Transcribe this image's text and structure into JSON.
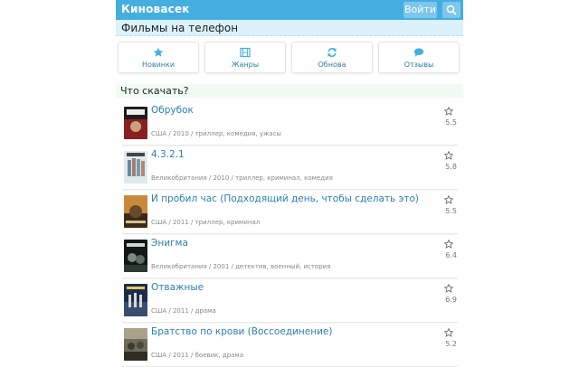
{
  "header": {
    "brand": "Киновасек",
    "login_label": "Войти"
  },
  "subheader": {
    "title": "Фильмы на телефон"
  },
  "nav": [
    {
      "label": "Новинки",
      "icon": "star-icon"
    },
    {
      "label": "Жанры",
      "icon": "film-icon"
    },
    {
      "label": "Обнова",
      "icon": "refresh-icon"
    },
    {
      "label": "Отзывы",
      "icon": "comment-icon"
    }
  ],
  "section": {
    "title": "Что скачать?"
  },
  "movies": [
    {
      "title": "Обрубок",
      "meta": "США / 2010 / триллер, комедия, ужасы",
      "rating": "5.5"
    },
    {
      "title": "4.3.2.1",
      "meta": "Великобритания / 2010 / триллер, криминал, комедия",
      "rating": "5.8"
    },
    {
      "title": "И пробил час (Подходящий день, чтобы сделать это)",
      "meta": "США / 2011 / триллер, криминал",
      "rating": "5.5"
    },
    {
      "title": "Энигма",
      "meta": "Великобритания / 2001 / детектив, военный, история",
      "rating": "6.4"
    },
    {
      "title": "Отважные",
      "meta": "США / 2011 / драма",
      "rating": "6.9"
    },
    {
      "title": "Братство по крови (Воссоединение)",
      "meta": "США / 2011 / боевик, драма",
      "rating": "5.2"
    }
  ],
  "colors": {
    "accent": "#44aee0",
    "link": "#2b7fae",
    "subheader_bg": "#dbf2fb",
    "section_bg": "#f0fbf4"
  }
}
